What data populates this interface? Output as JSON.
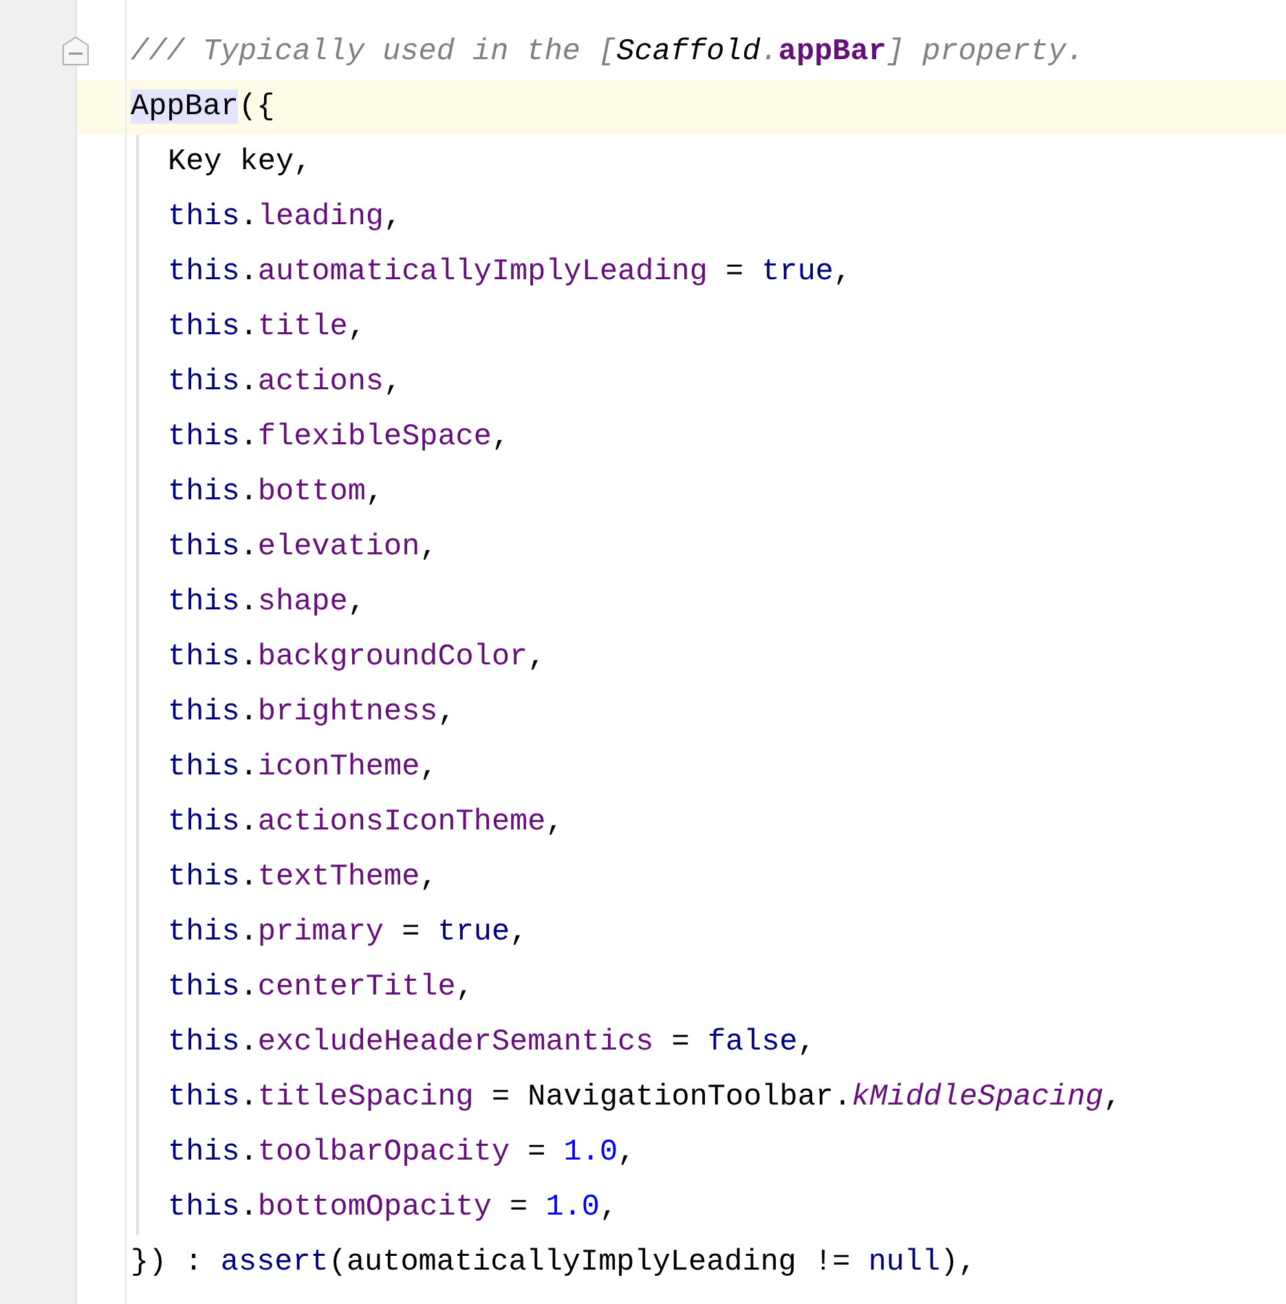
{
  "editor": {
    "lines": [
      {
        "current": false,
        "tokens": [
          {
            "kind": "comment",
            "text": "/// Typically used in the ["
          },
          {
            "kind": "doc-ref",
            "text": "Scaffold"
          },
          {
            "kind": "comment",
            "text": "."
          },
          {
            "kind": "doc-member",
            "text": "appBar"
          },
          {
            "kind": "comment",
            "text": "] property."
          }
        ],
        "fold": true
      },
      {
        "current": true,
        "tokens": [
          {
            "kind": "plain",
            "text": "AppBar",
            "highlighted": true
          },
          {
            "kind": "plain",
            "text": "({"
          }
        ],
        "children": [
          {
            "current": false,
            "tokens": [
              {
                "kind": "plain",
                "text": "Key key,"
              }
            ]
          },
          {
            "current": false,
            "tokens": [
              {
                "kind": "keyword",
                "text": "this"
              },
              {
                "kind": "plain",
                "text": "."
              },
              {
                "kind": "field",
                "text": "leading"
              },
              {
                "kind": "plain",
                "text": ","
              }
            ]
          },
          {
            "current": false,
            "tokens": [
              {
                "kind": "keyword",
                "text": "this"
              },
              {
                "kind": "plain",
                "text": "."
              },
              {
                "kind": "field",
                "text": "automaticallyImplyLeading"
              },
              {
                "kind": "plain",
                "text": " = "
              },
              {
                "kind": "keyword",
                "text": "true"
              },
              {
                "kind": "plain",
                "text": ","
              }
            ]
          },
          {
            "current": false,
            "tokens": [
              {
                "kind": "keyword",
                "text": "this"
              },
              {
                "kind": "plain",
                "text": "."
              },
              {
                "kind": "field",
                "text": "title"
              },
              {
                "kind": "plain",
                "text": ","
              }
            ]
          },
          {
            "current": false,
            "tokens": [
              {
                "kind": "keyword",
                "text": "this"
              },
              {
                "kind": "plain",
                "text": "."
              },
              {
                "kind": "field",
                "text": "actions"
              },
              {
                "kind": "plain",
                "text": ","
              }
            ]
          },
          {
            "current": false,
            "tokens": [
              {
                "kind": "keyword",
                "text": "this"
              },
              {
                "kind": "plain",
                "text": "."
              },
              {
                "kind": "field",
                "text": "flexibleSpace"
              },
              {
                "kind": "plain",
                "text": ","
              }
            ]
          },
          {
            "current": false,
            "tokens": [
              {
                "kind": "keyword",
                "text": "this"
              },
              {
                "kind": "plain",
                "text": "."
              },
              {
                "kind": "field",
                "text": "bottom"
              },
              {
                "kind": "plain",
                "text": ","
              }
            ]
          },
          {
            "current": false,
            "tokens": [
              {
                "kind": "keyword",
                "text": "this"
              },
              {
                "kind": "plain",
                "text": "."
              },
              {
                "kind": "field",
                "text": "elevation"
              },
              {
                "kind": "plain",
                "text": ","
              }
            ]
          },
          {
            "current": false,
            "tokens": [
              {
                "kind": "keyword",
                "text": "this"
              },
              {
                "kind": "plain",
                "text": "."
              },
              {
                "kind": "field",
                "text": "shape"
              },
              {
                "kind": "plain",
                "text": ","
              }
            ]
          },
          {
            "current": false,
            "tokens": [
              {
                "kind": "keyword",
                "text": "this"
              },
              {
                "kind": "plain",
                "text": "."
              },
              {
                "kind": "field",
                "text": "backgroundColor"
              },
              {
                "kind": "plain",
                "text": ","
              }
            ]
          },
          {
            "current": false,
            "tokens": [
              {
                "kind": "keyword",
                "text": "this"
              },
              {
                "kind": "plain",
                "text": "."
              },
              {
                "kind": "field",
                "text": "brightness"
              },
              {
                "kind": "plain",
                "text": ","
              }
            ]
          },
          {
            "current": false,
            "tokens": [
              {
                "kind": "keyword",
                "text": "this"
              },
              {
                "kind": "plain",
                "text": "."
              },
              {
                "kind": "field",
                "text": "iconTheme"
              },
              {
                "kind": "plain",
                "text": ","
              }
            ]
          },
          {
            "current": false,
            "tokens": [
              {
                "kind": "keyword",
                "text": "this"
              },
              {
                "kind": "plain",
                "text": "."
              },
              {
                "kind": "field",
                "text": "actionsIconTheme"
              },
              {
                "kind": "plain",
                "text": ","
              }
            ]
          },
          {
            "current": false,
            "tokens": [
              {
                "kind": "keyword",
                "text": "this"
              },
              {
                "kind": "plain",
                "text": "."
              },
              {
                "kind": "field",
                "text": "textTheme"
              },
              {
                "kind": "plain",
                "text": ","
              }
            ]
          },
          {
            "current": false,
            "tokens": [
              {
                "kind": "keyword",
                "text": "this"
              },
              {
                "kind": "plain",
                "text": "."
              },
              {
                "kind": "field",
                "text": "primary"
              },
              {
                "kind": "plain",
                "text": " = "
              },
              {
                "kind": "keyword",
                "text": "true"
              },
              {
                "kind": "plain",
                "text": ","
              }
            ]
          },
          {
            "current": false,
            "tokens": [
              {
                "kind": "keyword",
                "text": "this"
              },
              {
                "kind": "plain",
                "text": "."
              },
              {
                "kind": "field",
                "text": "centerTitle"
              },
              {
                "kind": "plain",
                "text": ","
              }
            ]
          },
          {
            "current": false,
            "tokens": [
              {
                "kind": "keyword",
                "text": "this"
              },
              {
                "kind": "plain",
                "text": "."
              },
              {
                "kind": "field",
                "text": "excludeHeaderSemantics"
              },
              {
                "kind": "plain",
                "text": " = "
              },
              {
                "kind": "keyword",
                "text": "false"
              },
              {
                "kind": "plain",
                "text": ","
              }
            ]
          },
          {
            "current": false,
            "tokens": [
              {
                "kind": "keyword",
                "text": "this"
              },
              {
                "kind": "plain",
                "text": "."
              },
              {
                "kind": "field",
                "text": "titleSpacing"
              },
              {
                "kind": "plain",
                "text": " = NavigationToolbar."
              },
              {
                "kind": "static",
                "text": "kMiddleSpacing"
              },
              {
                "kind": "plain",
                "text": ","
              }
            ]
          },
          {
            "current": false,
            "tokens": [
              {
                "kind": "keyword",
                "text": "this"
              },
              {
                "kind": "plain",
                "text": "."
              },
              {
                "kind": "field",
                "text": "toolbarOpacity"
              },
              {
                "kind": "plain",
                "text": " = "
              },
              {
                "kind": "number",
                "text": "1.0"
              },
              {
                "kind": "plain",
                "text": ","
              }
            ]
          },
          {
            "current": false,
            "tokens": [
              {
                "kind": "keyword",
                "text": "this"
              },
              {
                "kind": "plain",
                "text": "."
              },
              {
                "kind": "field",
                "text": "bottomOpacity"
              },
              {
                "kind": "plain",
                "text": " = "
              },
              {
                "kind": "number",
                "text": "1.0"
              },
              {
                "kind": "plain",
                "text": ","
              }
            ]
          }
        ]
      },
      {
        "current": false,
        "tokens": [
          {
            "kind": "plain",
            "text": "}) : "
          },
          {
            "kind": "keyword",
            "text": "assert"
          },
          {
            "kind": "plain",
            "text": "(automaticallyImplyLeading != "
          },
          {
            "kind": "keyword",
            "text": "null"
          },
          {
            "kind": "plain",
            "text": "),"
          }
        ]
      }
    ]
  }
}
